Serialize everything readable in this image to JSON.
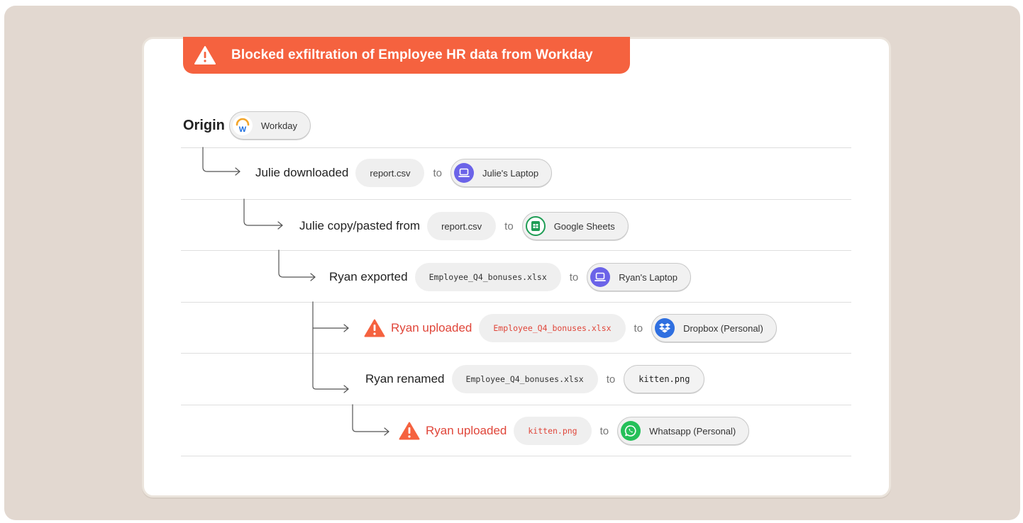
{
  "banner": {
    "title": "Blocked exfiltration of Employee HR data from Workday"
  },
  "origin": {
    "label": "Origin",
    "app": "Workday"
  },
  "connector": "to",
  "events": [
    {
      "verb": "Julie downloaded",
      "file": "report.csv",
      "target": "Julie's Laptop",
      "target_icon": "laptop-icon",
      "flagged": false
    },
    {
      "verb": "Julie copy/pasted from",
      "file": "report.csv",
      "target": "Google Sheets",
      "target_icon": "google-sheets-icon",
      "flagged": false
    },
    {
      "verb": "Ryan exported",
      "file": "Employee_Q4_bonuses.xlsx",
      "target": "Ryan's Laptop",
      "target_icon": "laptop-icon",
      "flagged": false
    },
    {
      "verb": "Ryan uploaded",
      "file": "Employee_Q4_bonuses.xlsx",
      "target": "Dropbox (Personal)",
      "target_icon": "dropbox-icon",
      "flagged": true
    },
    {
      "verb": "Ryan renamed",
      "file": "Employee_Q4_bonuses.xlsx",
      "target": "kitten.png",
      "target_icon": "",
      "flagged": false
    },
    {
      "verb": "Ryan uploaded",
      "file": "kitten.png",
      "target": "Whatsapp (Personal)",
      "target_icon": "whatsapp-icon",
      "flagged": true
    }
  ],
  "colors": {
    "alert": "#f5623f",
    "danger_text": "#e0463a",
    "laptop": "#6b63e8",
    "sheets": "#1f9d55",
    "dropbox": "#2f6fe0",
    "whatsapp": "#25c05a",
    "workday": "#f3a52a"
  }
}
